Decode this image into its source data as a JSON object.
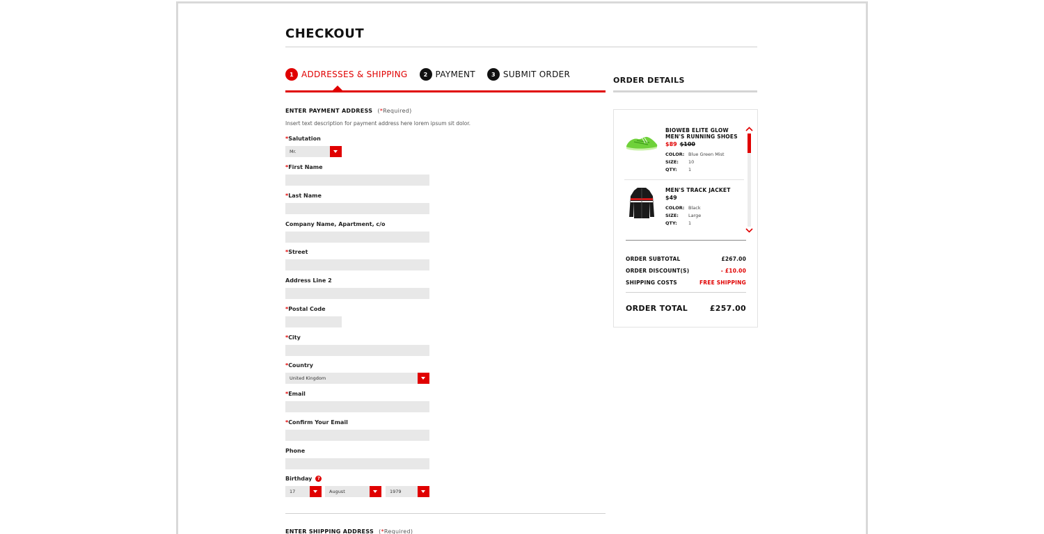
{
  "page": {
    "title": "CHECKOUT"
  },
  "steps": [
    {
      "num": "1",
      "label": "ADDRESSES & SHIPPING",
      "active": true
    },
    {
      "num": "2",
      "label": "PAYMENT",
      "active": false
    },
    {
      "num": "3",
      "label": "SUBMIT ORDER",
      "active": false
    }
  ],
  "payment_address": {
    "heading": "ENTER PAYMENT ADDRESS",
    "required_star": "*",
    "required_word": "Required",
    "description": "Insert text description for payment address here lorem ipsum sit dolor.",
    "fields": {
      "salutation": {
        "label": "Salutation",
        "required": true,
        "value": "Mr."
      },
      "first_name": {
        "label": "First Name",
        "required": true,
        "value": ""
      },
      "last_name": {
        "label": "Last Name",
        "required": true,
        "value": ""
      },
      "company": {
        "label": "Company Name, Apartment, c/o",
        "required": false,
        "value": ""
      },
      "street": {
        "label": "Street",
        "required": true,
        "value": ""
      },
      "address2": {
        "label": "Address Line 2",
        "required": false,
        "value": ""
      },
      "postal_code": {
        "label": "Postal Code",
        "required": true,
        "value": ""
      },
      "city": {
        "label": "City",
        "required": true,
        "value": ""
      },
      "country": {
        "label": "Country",
        "required": true,
        "value": "United Kingdom"
      },
      "email": {
        "label": "Email",
        "required": true,
        "value": ""
      },
      "confirm_email": {
        "label": "Confirm Your Email",
        "required": true,
        "value": ""
      },
      "phone": {
        "label": "Phone",
        "required": false,
        "value": ""
      },
      "birthday": {
        "label": "Birthday",
        "required": false,
        "day": "17",
        "month": "August",
        "year": "1979"
      }
    }
  },
  "shipping_address": {
    "heading": "ENTER SHIPPING ADDRESS",
    "required_star": "*",
    "required_word": "Required"
  },
  "order_details": {
    "title": "ORDER DETAILS",
    "items": [
      {
        "name": "BIOWEB ELITE GLOW MEN'S RUNNING SHOES",
        "price": "$89",
        "old_price": "$100",
        "color": "Blue Green Mist",
        "size": "10",
        "qty": "1"
      },
      {
        "name": "MEN'S TRACK JACKET",
        "price": "$49",
        "old_price": "",
        "color": "Black",
        "size": "Large",
        "qty": "1"
      }
    ],
    "attr_labels": {
      "color": "COLOR:",
      "size": "SIZE:",
      "qty": "QTY:"
    },
    "subtotal_label": "ORDER SUBTOTAL",
    "subtotal": "£267.00",
    "discount_label": "ORDER DISCOUNT(S)",
    "discount": "- £10.00",
    "shipping_label": "SHIPPING COSTS",
    "shipping": "FREE SHIPPING",
    "total_label": "ORDER TOTAL",
    "total": "£257.00"
  },
  "icons": {
    "help": "question-icon",
    "dropdown": "chevron-down-icon",
    "scroll_up": "chevron-up-icon",
    "scroll_down": "chevron-down-icon"
  },
  "colors": {
    "accent": "#e00000",
    "input_bg": "#e8e8e8",
    "text": "#111111"
  }
}
